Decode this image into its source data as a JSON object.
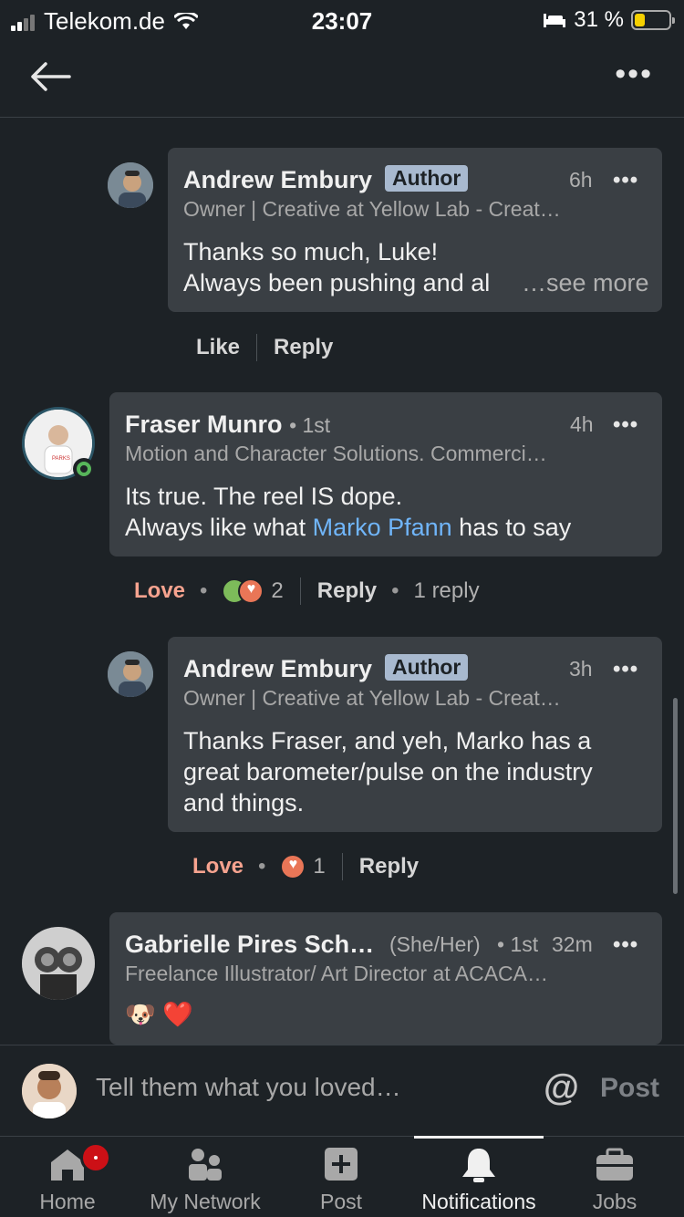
{
  "status_bar": {
    "carrier": "Telekom.de",
    "time": "23:07",
    "battery": "31 %"
  },
  "comments": [
    {
      "name": "Andrew Embury",
      "badge": "Author",
      "time": "6h",
      "headline": "Owner | Creative at Yellow Lab - Creat…",
      "line1": "Thanks so much, Luke!",
      "line2": "Always been pushing and al",
      "see_more": "…see more",
      "like": "Like",
      "reply": "Reply"
    },
    {
      "name": "Fraser Munro",
      "degree": "• 1st",
      "time": "4h",
      "headline": "Motion and Character Solutions. Commerci…",
      "line1": "Its true. The reel IS dope.",
      "line2_pre": "Always like what ",
      "mention": "Marko Pfann",
      "line2_post": " has to say",
      "reaction": "Love",
      "reaction_count": "2",
      "reply": "Reply",
      "replies": "1 reply"
    },
    {
      "name": "Andrew Embury",
      "badge": "Author",
      "time": "3h",
      "headline": "Owner | Creative at Yellow Lab - Creat…",
      "line1": "Thanks Fraser, and yeh, Marko has a",
      "line2": "great barometer/pulse on the industry",
      "line3": "and things.",
      "reaction": "Love",
      "reaction_count": "1",
      "reply": "Reply"
    },
    {
      "name": "Gabrielle Pires Sch…",
      "pronouns": "(She/Her)",
      "degree": "• 1st",
      "time": "32m",
      "headline": "Freelance Illustrator/ Art Director at ACACA…",
      "text": "🐶 ❤️"
    }
  ],
  "compose": {
    "placeholder": "Tell them what you loved…",
    "mention_icon": "@",
    "post": "Post"
  },
  "tabs": [
    {
      "label": "Home",
      "icon": "home-icon"
    },
    {
      "label": "My Network",
      "icon": "network-icon"
    },
    {
      "label": "Post",
      "icon": "post-icon"
    },
    {
      "label": "Notifications",
      "icon": "bell-icon"
    },
    {
      "label": "Jobs",
      "icon": "briefcase-icon"
    }
  ],
  "colors": {
    "background": "#1d2226",
    "bubble": "#3a3f44",
    "link": "#70b5f9",
    "love": "#f6a38f",
    "badge": "#a8b9cf",
    "notification": "#cc1016"
  }
}
